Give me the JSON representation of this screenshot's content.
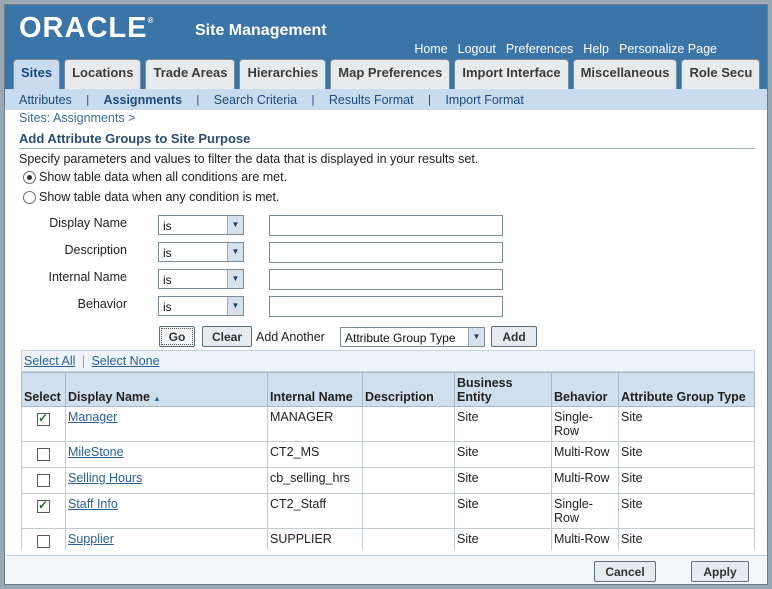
{
  "header": {
    "logo": "ORACLE",
    "logo_mark": "®",
    "title": "Site Management",
    "global_links": [
      "Home",
      "Logout",
      "Preferences",
      "Help",
      "Personalize Page"
    ]
  },
  "tabs": [
    "Sites",
    "Locations",
    "Trade Areas",
    "Hierarchies",
    "Map Preferences",
    "Import Interface",
    "Miscellaneous",
    "Role Secu"
  ],
  "subtabs": [
    "Attributes",
    "Assignments",
    "Search Criteria",
    "Results Format",
    "Import Format"
  ],
  "breadcrumb": "Sites: Assignments  >",
  "page_title": "Add Attribute Groups to Site Purpose",
  "instructions": "Specify parameters and values to filter the data that is displayed in your results set.",
  "radios": {
    "all": "Show table data when all conditions are met.",
    "any": "Show table data when any condition is met."
  },
  "criteria": [
    {
      "label": "Display Name",
      "operator": "is",
      "value": ""
    },
    {
      "label": "Description",
      "operator": "is",
      "value": ""
    },
    {
      "label": "Internal Name",
      "operator": "is",
      "value": ""
    },
    {
      "label": "Behavior",
      "operator": "is",
      "value": ""
    }
  ],
  "buttons": {
    "go": "Go",
    "clear": "Clear",
    "add_another": "Add Another",
    "add_select": "Attribute Group Type",
    "add": "Add",
    "cancel": "Cancel",
    "apply": "Apply"
  },
  "select_links": {
    "all": "Select All",
    "none": "Select None"
  },
  "table": {
    "headers": [
      "Select",
      "Display Name",
      "Internal Name",
      "Description",
      "Business Entity",
      "Behavior",
      "Attribute Group Type"
    ],
    "rows": [
      {
        "checked": true,
        "display": "Manager",
        "internal": "MANAGER",
        "description": "",
        "entity": "Site",
        "behavior": "Single-Row",
        "type": "Site"
      },
      {
        "checked": false,
        "display": "MileStone",
        "internal": "CT2_MS",
        "description": "",
        "entity": "Site",
        "behavior": "Multi-Row",
        "type": "Site"
      },
      {
        "checked": false,
        "display": "Selling Hours",
        "internal": "cb_selling_hrs",
        "description": "",
        "entity": "Site",
        "behavior": "Multi-Row",
        "type": "Site"
      },
      {
        "checked": true,
        "display": "Staff Info",
        "internal": "CT2_Staff",
        "description": "",
        "entity": "Site",
        "behavior": "Single-Row",
        "type": "Site"
      },
      {
        "checked": false,
        "display": "Supplier",
        "internal": "SUPPLIER",
        "description": "",
        "entity": "Site",
        "behavior": "Multi-Row",
        "type": "Site"
      }
    ]
  }
}
